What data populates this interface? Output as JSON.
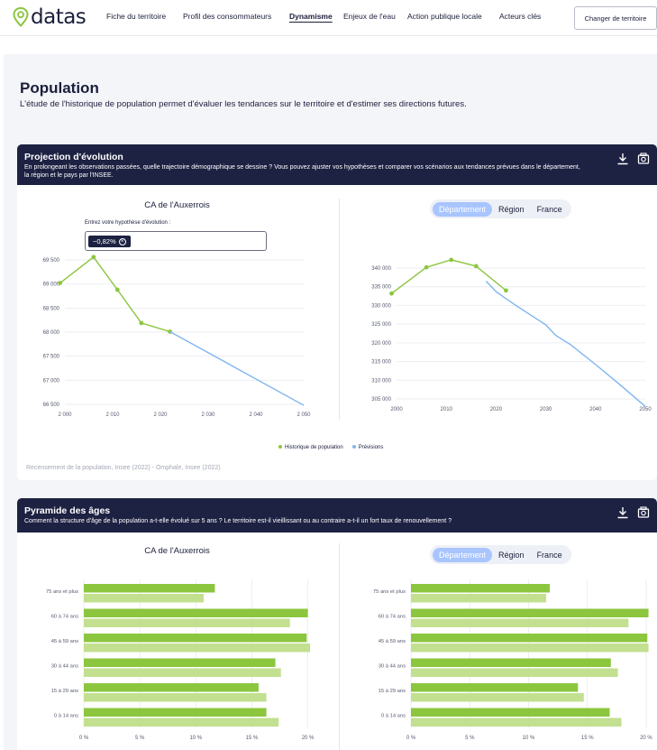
{
  "app": {
    "logo_text": "datas"
  },
  "nav": {
    "items": [
      {
        "label": "Fiche du territoire",
        "active": false
      },
      {
        "label": "Profil des consommateurs",
        "active": false
      },
      {
        "label": "Dynamisme",
        "active": true
      },
      {
        "label": "Enjeux de l'eau",
        "active": false
      },
      {
        "label": "Action publique locale",
        "active": false
      },
      {
        "label": "Acteurs clés",
        "active": false
      }
    ],
    "change_button": "Changer de territoire"
  },
  "page": {
    "title": "Population",
    "subtitle": "L'étude de l'historique de population permet d'évaluer les tendances sur le territoire et d'estimer ses directions futures."
  },
  "projection": {
    "title": "Projection d'évolution",
    "desc": "En prolongeant les observations passées, quelle trajectoire démographique se dessine ? Vous pouvez ajuster vos hypothèses et comparer vos scénarios aux tendances prévues dans le département, la région et le pays par l'INSEE.",
    "left_title": "CA de l'Auxerrois",
    "hypothesis_label": "Entrez votre hypothèse d'évolution :",
    "hypothesis_value": "−0,82%",
    "segments": [
      "Département",
      "Région",
      "France"
    ],
    "segment_selected": "Département",
    "legend": [
      "Historique de population",
      "Prévisions"
    ],
    "source": "Recensement de la population, Insee (2022) - Omphale, Insee (2022)"
  },
  "pyramid": {
    "title": "Pyramide des âges",
    "desc": "Comment la structure d'âge de la population a-t-elle évolué sur 5 ans ? Le territoire est-il vieillissant ou au contraire a-t-il un fort taux de renouvellement ?",
    "left_title": "CA de l'Auxerrois",
    "segments": [
      "Département",
      "Région",
      "France"
    ],
    "segment_selected": "Département"
  },
  "colors": {
    "history": "#8cc63f",
    "forecast": "#7fb5f0",
    "bar_dark": "#8cc63f",
    "bar_light": "#c2e08f",
    "header": "#1d2142"
  },
  "icons": [
    "location-pin-icon",
    "download-icon",
    "camera-icon"
  ],
  "chart_data": [
    {
      "type": "line",
      "ylim": [
        66500,
        69500
      ],
      "xlim": [
        2000,
        2050
      ],
      "x_ticks": [
        2000,
        2010,
        2020,
        2030,
        2040,
        2050
      ],
      "y_ticks": [
        66500,
        67000,
        67500,
        68000,
        68500,
        69000,
        69500
      ],
      "x_tick_labels": [
        "2 000",
        "2 010",
        "2 020",
        "2 030",
        "2 040",
        "2 050"
      ],
      "y_tick_labels": [
        "66 500",
        "67 000",
        "67 500",
        "68 000",
        "68 500",
        "69 000",
        "69 500"
      ],
      "series": [
        {
          "name": "Historique de population",
          "x": [
            1999,
            2006,
            2011,
            2016,
            2022
          ],
          "y": [
            69020,
            69560,
            68880,
            68190,
            68010
          ]
        },
        {
          "name": "Prévisions",
          "x": [
            2022,
            2050
          ],
          "y": [
            68010,
            66480
          ]
        }
      ]
    },
    {
      "type": "line",
      "ylim": [
        305000,
        340000
      ],
      "xlim": [
        2000,
        2050
      ],
      "x_ticks": [
        2000,
        2010,
        2020,
        2030,
        2040,
        2050
      ],
      "y_ticks": [
        305000,
        310000,
        315000,
        320000,
        325000,
        330000,
        335000,
        340000
      ],
      "x_tick_labels": [
        "2000",
        "2010",
        "2020",
        "2030",
        "2040",
        "2050"
      ],
      "y_tick_labels": [
        "305 000",
        "310 000",
        "315 000",
        "320 000",
        "325 000",
        "330 000",
        "335 000",
        "340 000"
      ],
      "series": [
        {
          "name": "Historique de population",
          "x": [
            1999,
            2006,
            2011,
            2016,
            2022
          ],
          "y": [
            333200,
            340200,
            342200,
            340500,
            334000
          ]
        },
        {
          "name": "Prévisions",
          "x": [
            2018,
            2020,
            2022,
            2024,
            2027,
            2030,
            2032,
            2035,
            2040,
            2045,
            2050
          ],
          "y": [
            336500,
            333700,
            331800,
            330000,
            327400,
            324800,
            322000,
            319500,
            314200,
            308700,
            303000
          ]
        }
      ]
    },
    {
      "type": "bar",
      "orientation": "horizontal",
      "categories": [
        "75 ans et plus",
        "60 à 74 ans",
        "45 à 59 ans",
        "30 à 44 ans",
        "15 à 29 ans",
        "0 à 14 ans"
      ],
      "series": [
        {
          "values": [
            11.7,
            20.0,
            19.9,
            17.1,
            15.6,
            16.3
          ]
        },
        {
          "values": [
            10.7,
            18.4,
            20.2,
            17.6,
            16.3,
            17.4
          ]
        }
      ],
      "x_ticks": [
        0,
        5,
        10,
        15,
        20
      ],
      "x_tick_labels": [
        "0 %",
        "5 %",
        "10 %",
        "15 %",
        "20 %"
      ],
      "xlim": [
        0,
        21
      ]
    },
    {
      "type": "bar",
      "orientation": "horizontal",
      "categories": [
        "75 ans et plus",
        "60 à 74 ans",
        "45 à 59 ans",
        "30 à 44 ans",
        "15 à 29 ans",
        "0 à 14 ans"
      ],
      "series": [
        {
          "values": [
            11.8,
            20.2,
            20.1,
            17.0,
            14.2,
            16.9
          ]
        },
        {
          "values": [
            11.5,
            18.5,
            20.2,
            17.6,
            14.7,
            17.9
          ]
        }
      ],
      "x_ticks": [
        0,
        5,
        10,
        15,
        20
      ],
      "x_tick_labels": [
        "0 %",
        "5 %",
        "10 %",
        "15 %",
        "20 %"
      ],
      "xlim": [
        0,
        21
      ]
    }
  ]
}
